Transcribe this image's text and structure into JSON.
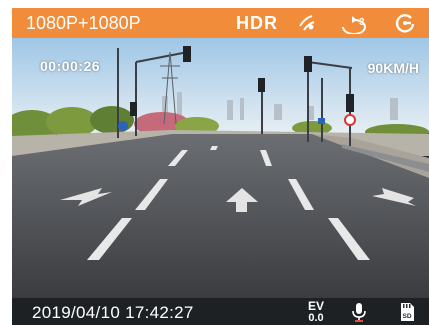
{
  "status_bar": {
    "resolution": "1080P+1080P",
    "hdr": "HDR",
    "icons": [
      "road-detection-icon",
      "loop-recording-3min-icon",
      "gps-icon"
    ]
  },
  "overlay": {
    "timer": "00:00:26",
    "speed": "90KM/H"
  },
  "bottom_bar": {
    "datetime": "2019/04/10  17:42:27",
    "ev_label": "EV",
    "ev_value": "0.0",
    "icons": [
      "microphone-icon",
      "sd-card-icon"
    ]
  },
  "icon_text": {
    "loop_minutes": "3",
    "sd_label": "SD"
  },
  "colors": {
    "accent": "#f08c3a",
    "mic_accent": "#e84c3d",
    "bottom_bar": "#1c1e22"
  }
}
